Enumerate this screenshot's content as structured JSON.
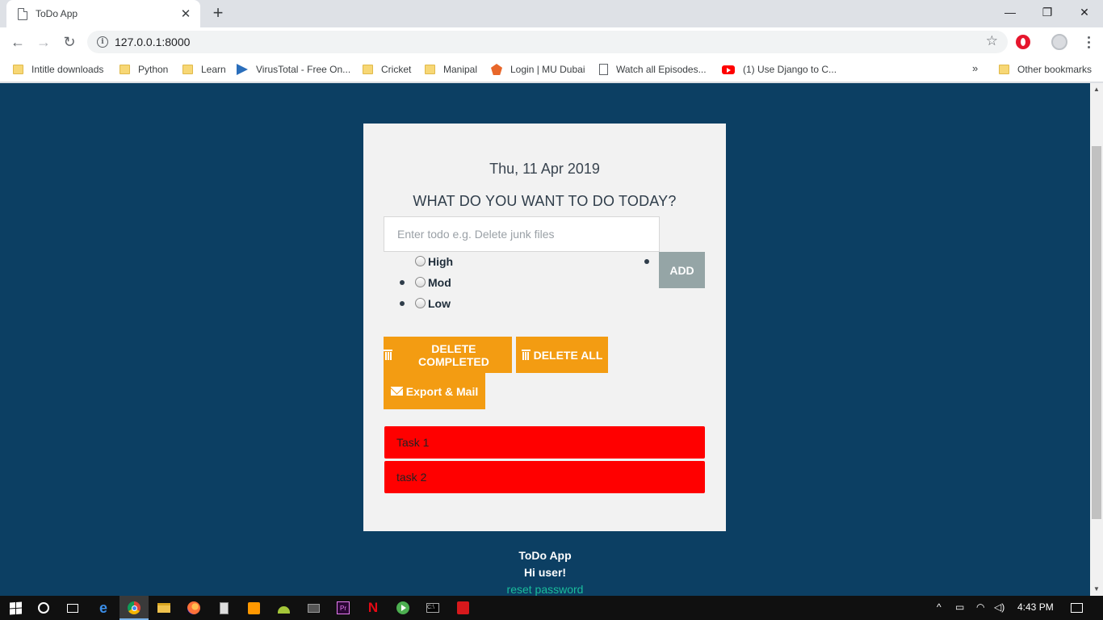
{
  "browser": {
    "tab_title": "ToDo App",
    "url": "127.0.0.1:8000",
    "bookmarks": [
      {
        "label": "Intitle downloads",
        "icon": "folder-icon"
      },
      {
        "label": "Python",
        "icon": "folder-icon"
      },
      {
        "label": "Learn",
        "icon": "folder-icon"
      },
      {
        "label": "VirusTotal - Free On...",
        "icon": "virustotal-icon"
      },
      {
        "label": "Cricket",
        "icon": "folder-icon"
      },
      {
        "label": "Manipal",
        "icon": "folder-icon"
      },
      {
        "label": "Login | MU Dubai",
        "icon": "mu-icon"
      },
      {
        "label": "Watch all Episodes...",
        "icon": "page-icon"
      },
      {
        "label": "(1) Use Django to C...",
        "icon": "youtube-icon"
      }
    ],
    "other_bookmarks": "Other bookmarks"
  },
  "app": {
    "date": "Thu, 11 Apr 2019",
    "heading": "WHAT DO YOU WANT TO DO TODAY?",
    "input_placeholder": "Enter todo e.g. Delete junk files",
    "add_label": "ADD",
    "priorities": [
      "High",
      "Mod",
      "Low"
    ],
    "delete_completed_label": "DELETE COMPLETED",
    "delete_all_label": "DELETE ALL",
    "export_label": "Export & Mail",
    "tasks": [
      "Task 1",
      "task 2"
    ],
    "task_color": "#ff0000",
    "accent_color": "#f39c12",
    "background_color": "#0c3f63"
  },
  "footer": {
    "app_name": "ToDo App",
    "greeting": "Hi user!",
    "reset_link": "reset password"
  },
  "taskbar": {
    "time": "4:43 PM"
  }
}
